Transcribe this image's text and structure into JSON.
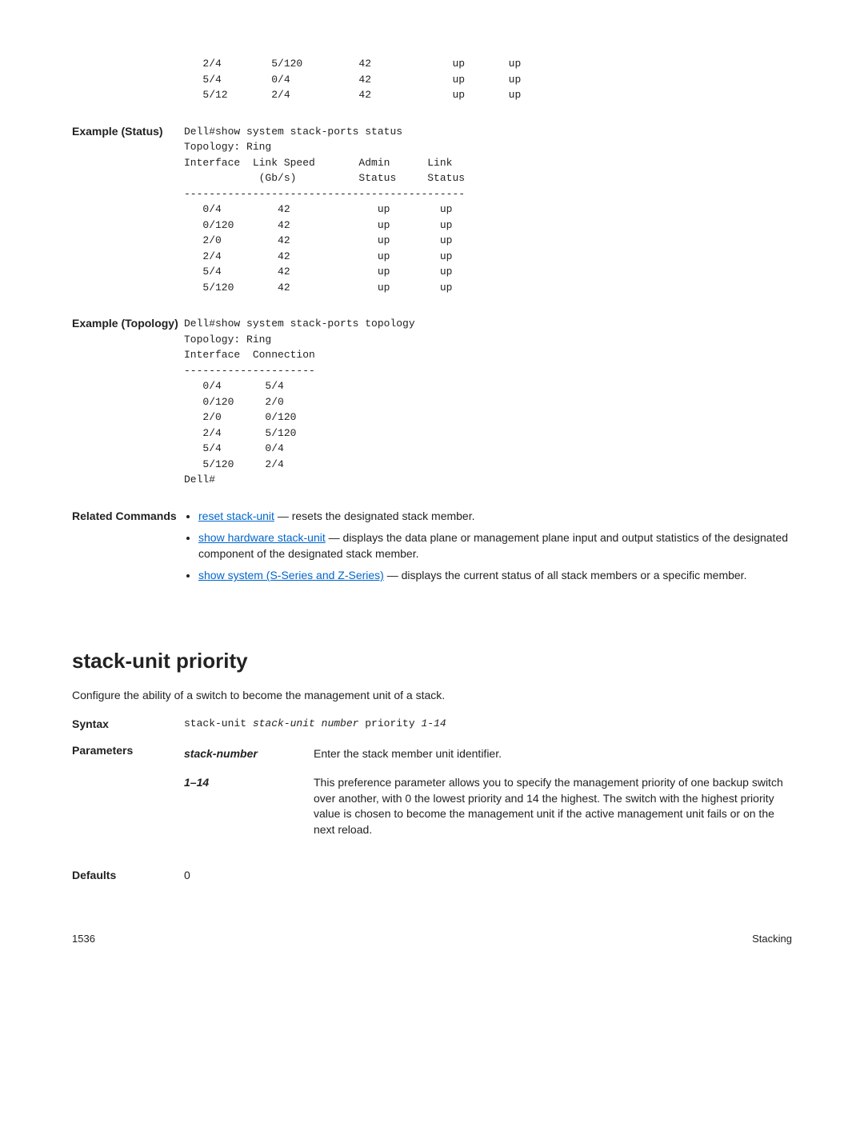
{
  "top_pre": "   2/4        5/120         42             up       up\n   5/4        0/4           42             up       up\n   5/12       2/4           42             up       up",
  "example_status": {
    "label": "Example (Status)",
    "pre": "Dell#show system stack-ports status\nTopology: Ring\nInterface  Link Speed       Admin      Link\n            (Gb/s)          Status     Status\n---------------------------------------------\n   0/4         42              up        up\n   0/120       42              up        up\n   2/0         42              up        up\n   2/4         42              up        up\n   5/4         42              up        up\n   5/120       42              up        up"
  },
  "example_topology": {
    "label": "Example (Topology)",
    "pre": "Dell#show system stack-ports topology\nTopology: Ring\nInterface  Connection\n---------------------\n   0/4       5/4\n   0/120     2/0\n   2/0       0/120\n   2/4       5/120\n   5/4       0/4\n   5/120     2/4\nDell#"
  },
  "related": {
    "label": "Related Commands",
    "items": [
      {
        "link": "reset stack-unit",
        "rest": " — resets the designated stack member."
      },
      {
        "link": "show hardware stack-unit",
        "rest": " — displays the data plane or management plane input and output statistics of the designated component of the designated stack member."
      },
      {
        "link": "show system (S-Series and Z-Series)",
        "rest": " — displays the current status of all stack members or a specific member."
      }
    ]
  },
  "section": {
    "title": "stack-unit priority",
    "intro": "Configure the ability of a switch to become the management unit of a stack."
  },
  "syntax": {
    "label": "Syntax",
    "text_pre": "stack-unit ",
    "italic1": "stack-unit number",
    "mid": " priority ",
    "italic2": "1-14"
  },
  "parameters": {
    "label": "Parameters",
    "rows": [
      {
        "name": "stack-number",
        "desc": "Enter the stack member unit identifier."
      },
      {
        "name": "1–14",
        "desc": "This preference parameter allows you to specify the management priority of one backup switch over another, with 0 the lowest priority and 14 the highest. The switch with the highest priority value is chosen to become the management unit if the active management unit fails or on the next reload."
      }
    ]
  },
  "defaults": {
    "label": "Defaults",
    "value": "0"
  },
  "footer": {
    "page": "1536",
    "section": "Stacking"
  }
}
